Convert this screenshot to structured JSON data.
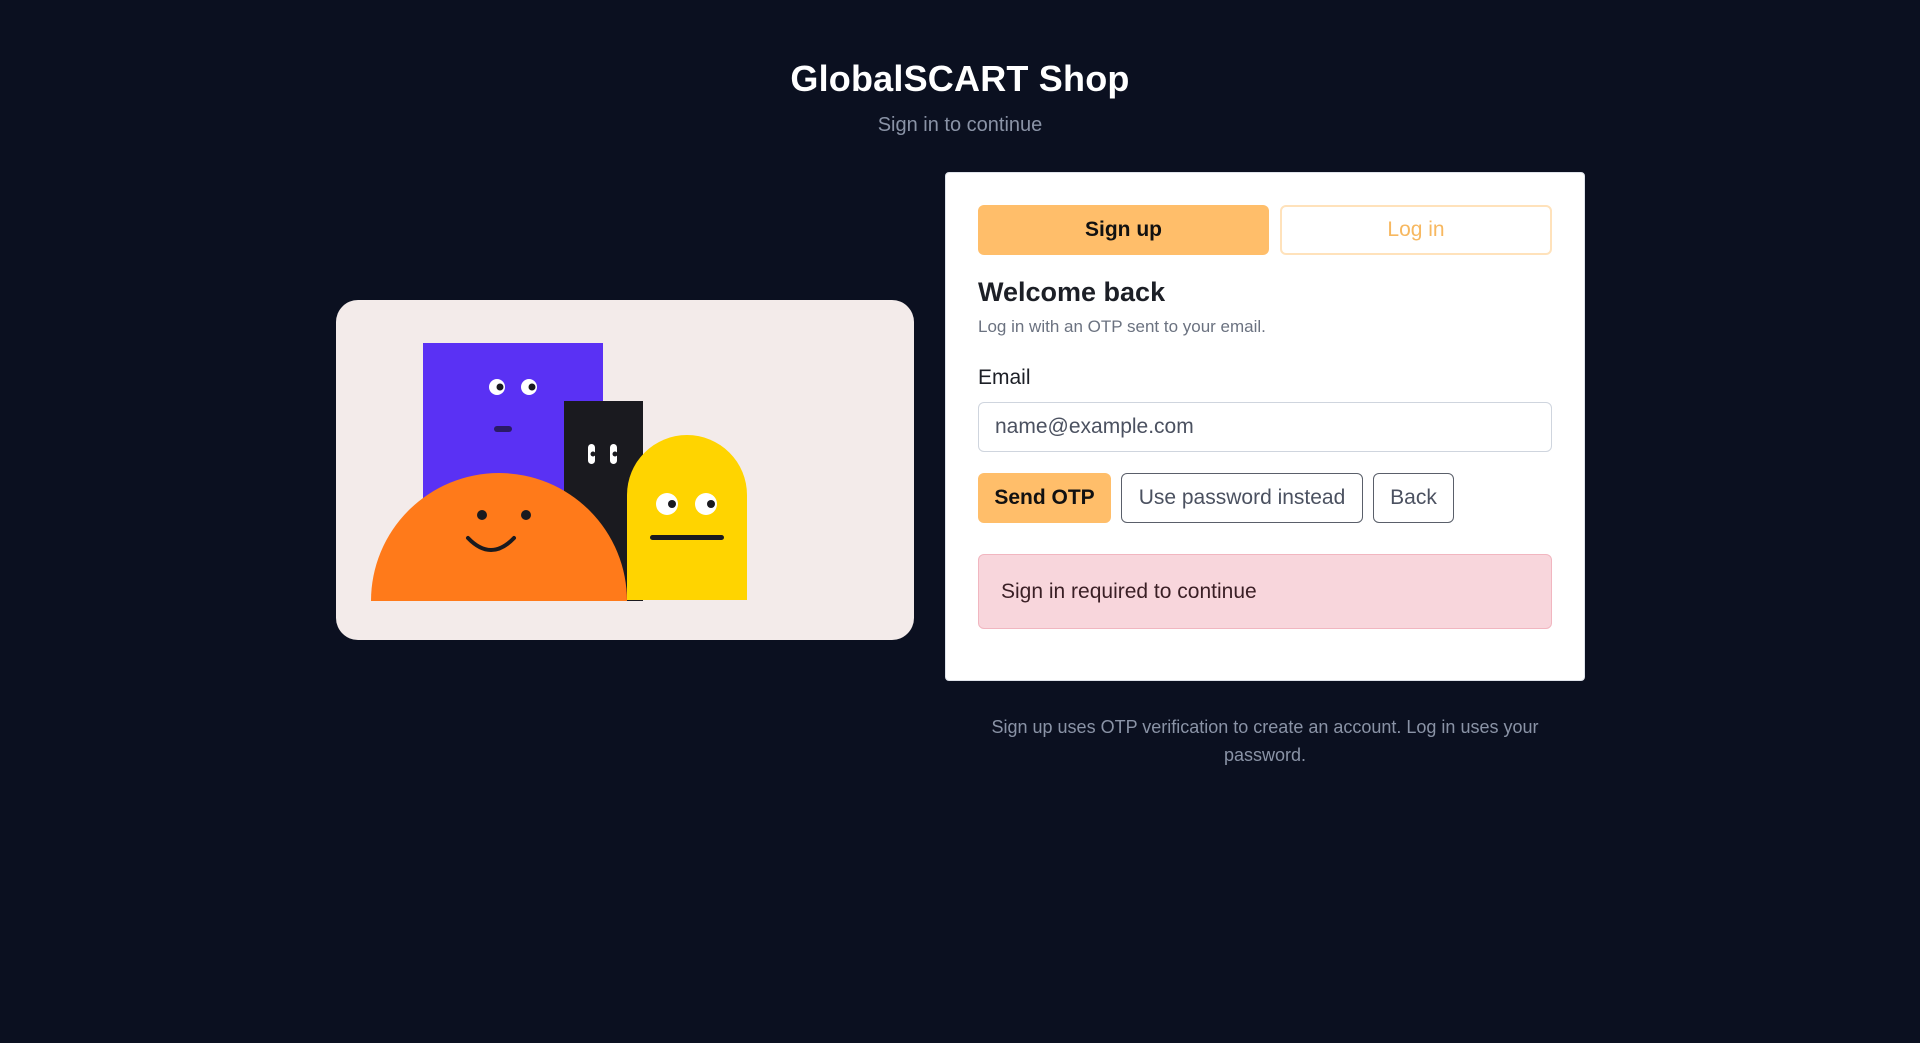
{
  "header": {
    "title": "GlobalSCART Shop",
    "subtitle": "Sign in to continue"
  },
  "illustration": {
    "colors": {
      "background": "#f3ebea",
      "purple": "#5a31f4",
      "black": "#1a1a1f",
      "orange": "#ff7a1a",
      "yellow": "#ffd400"
    }
  },
  "auth": {
    "tabs": {
      "signup_label": "Sign up",
      "login_label": "Log in",
      "active": "signup"
    },
    "heading": "Welcome back",
    "description": "Log in with an OTP sent to your email.",
    "email": {
      "label": "Email",
      "placeholder": "name@example.com",
      "value": ""
    },
    "buttons": {
      "send_otp": "Send OTP",
      "use_password": "Use password instead",
      "back": "Back"
    },
    "alert": "Sign in required to continue"
  },
  "footnote": "Sign up uses OTP verification to create an account. Log in uses your password.",
  "colors": {
    "page_background": "#0b1020",
    "accent": "#ffbe6a",
    "alert_background": "#f8d6dc"
  }
}
